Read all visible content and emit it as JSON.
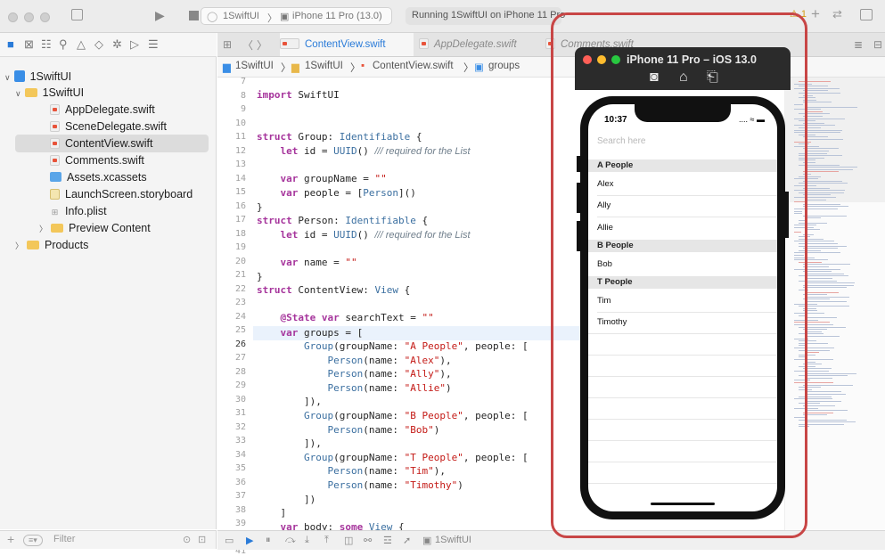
{
  "window": {
    "scheme": "1SwiftUI",
    "device": "iPhone 11 Pro (13.0)",
    "status": "Running 1SwiftUI on iPhone 11 Pro",
    "warning_count": "1"
  },
  "navigator": {
    "items": [
      {
        "label": "1SwiftUI",
        "kind": "project"
      },
      {
        "label": "1SwiftUI",
        "kind": "folder"
      },
      {
        "label": "AppDelegate.swift",
        "kind": "swift"
      },
      {
        "label": "SceneDelegate.swift",
        "kind": "swift"
      },
      {
        "label": "ContentView.swift",
        "kind": "swift",
        "selected": true
      },
      {
        "label": "Comments.swift",
        "kind": "swift"
      },
      {
        "label": "Assets.xcassets",
        "kind": "assets"
      },
      {
        "label": "LaunchScreen.storyboard",
        "kind": "storyboard"
      },
      {
        "label": "Info.plist",
        "kind": "plist"
      },
      {
        "label": "Preview Content",
        "kind": "folder"
      },
      {
        "label": "Products",
        "kind": "folder"
      }
    ],
    "filter_placeholder": "Filter"
  },
  "editor": {
    "tabs": [
      "ContentView.swift",
      "AppDelegate.swift",
      "Comments.swift"
    ],
    "breadcrumb": [
      "1SwiftUI",
      "1SwiftUI",
      "ContentView.swift",
      "groups"
    ],
    "line_numbers": [
      "7",
      "8",
      "9",
      "10",
      "11",
      "12",
      "13",
      "14",
      "15",
      "16",
      "17",
      "18",
      "19",
      "20",
      "21",
      "22",
      "23",
      "24",
      "25",
      "26",
      "27",
      "28",
      "29",
      "30",
      "31",
      "32",
      "33",
      "34",
      "35",
      "36",
      "37",
      "38",
      "39",
      "40",
      "41"
    ],
    "current_line": "26",
    "debug_target": "1SwiftUI"
  },
  "simulator": {
    "title": "iPhone 11 Pro – iOS 13.0",
    "time": "10:37",
    "search_placeholder": "Search here",
    "sections": [
      {
        "header": "A People",
        "rows": [
          "Alex",
          "Ally",
          "Allie"
        ]
      },
      {
        "header": "B People",
        "rows": [
          "Bob"
        ]
      },
      {
        "header": "T People",
        "rows": [
          "Tim",
          "Timothy"
        ]
      }
    ]
  }
}
